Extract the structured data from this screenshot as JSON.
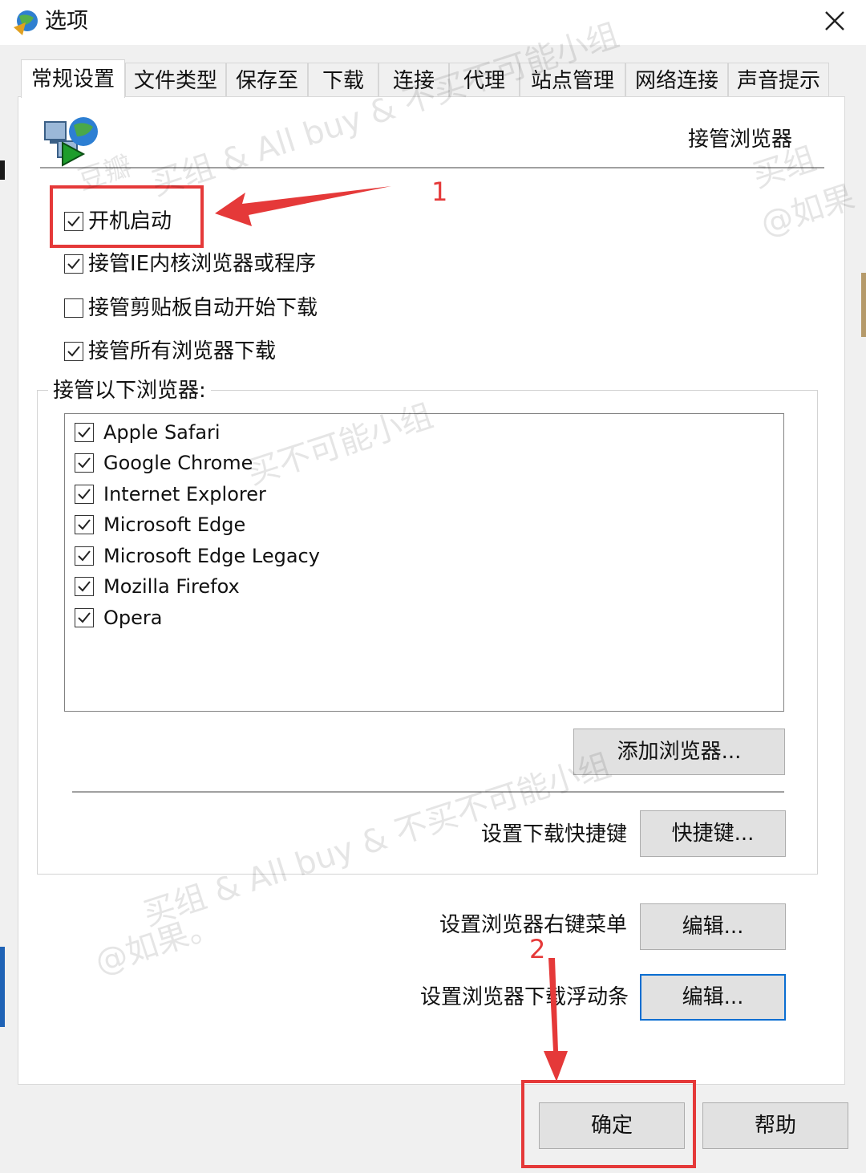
{
  "window": {
    "title": "选项",
    "close_symbol": "✕"
  },
  "tabs": [
    {
      "label": "常规设置",
      "active": true
    },
    {
      "label": "文件类型"
    },
    {
      "label": "保存至"
    },
    {
      "label": "下载"
    },
    {
      "label": "连接"
    },
    {
      "label": "代理"
    },
    {
      "label": "站点管理"
    },
    {
      "label": "网络连接"
    },
    {
      "label": "声音提示"
    }
  ],
  "header": {
    "title": "接管浏览器",
    "icon": "network-globe-arrow-icon"
  },
  "options": [
    {
      "label": "开机启动",
      "checked": true
    },
    {
      "label": "接管IE内核浏览器或程序",
      "checked": true
    },
    {
      "label": "接管剪贴板自动开始下载",
      "checked": false
    },
    {
      "label": "接管所有浏览器下载",
      "checked": true
    }
  ],
  "browser_group": {
    "title": "接管以下浏览器:",
    "browsers": [
      {
        "label": "Apple Safari",
        "checked": true
      },
      {
        "label": "Google Chrome",
        "checked": true
      },
      {
        "label": "Internet Explorer",
        "checked": true
      },
      {
        "label": "Microsoft Edge",
        "checked": true
      },
      {
        "label": "Microsoft Edge Legacy",
        "checked": true
      },
      {
        "label": "Mozilla Firefox",
        "checked": true
      },
      {
        "label": "Opera",
        "checked": true
      }
    ],
    "add_button": "添加浏览器...",
    "shortcut_label": "设置下载快捷键",
    "shortcut_button": "快捷键..."
  },
  "context_menu": {
    "label": "设置浏览器右键菜单",
    "button": "编辑..."
  },
  "float_bar": {
    "label": "设置浏览器下载浮动条",
    "button": "编辑..."
  },
  "footer": {
    "ok": "确定",
    "help": "帮助"
  },
  "annotations": {
    "step1": "1",
    "step2": "2",
    "color": "#e53939"
  },
  "watermarks": [
    "买组 & All buy & 不买不可能小组",
    "@如果。",
    "豆瓣",
    "买组",
    "@如果",
    "买不可能小组"
  ]
}
